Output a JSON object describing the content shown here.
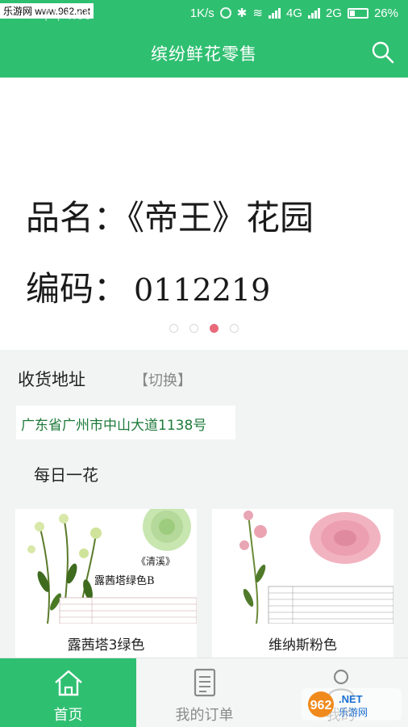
{
  "status_bar": {
    "watermark": "乐游网 www.962.net",
    "time": "下午4:00",
    "speed": "1K/s",
    "net1": "4G",
    "net2": "2G",
    "battery": "26%"
  },
  "header": {
    "title": "缤纷鲜花零售",
    "search_icon": "search-icon"
  },
  "banner": {
    "line1": "品名：《帝王》花园",
    "line2_label": "编码：",
    "line2_code": "0112219",
    "dot_count": 4,
    "active_dot": 3
  },
  "address": {
    "label": "收货地址",
    "switch": "【切换】",
    "value": "广东省广州市中山大道1138号"
  },
  "daily": {
    "title": "每日一花"
  },
  "products": [
    {
      "name": "露茜塔3绿色",
      "image_caption": "《清溪》",
      "image_subtitle": "露茜塔绿色B"
    },
    {
      "name": "维纳斯粉色"
    }
  ],
  "tabbar": {
    "tabs": [
      {
        "label": "首页",
        "icon": "home-icon",
        "active": true
      },
      {
        "label": "我的订单",
        "icon": "order-list-icon",
        "active": false
      },
      {
        "label": "我的",
        "icon": "user-icon",
        "active": false
      }
    ]
  },
  "colors": {
    "primary": "#2fbf71",
    "accent_dot": "#e86a7a",
    "address_text": "#1e7a3a"
  }
}
